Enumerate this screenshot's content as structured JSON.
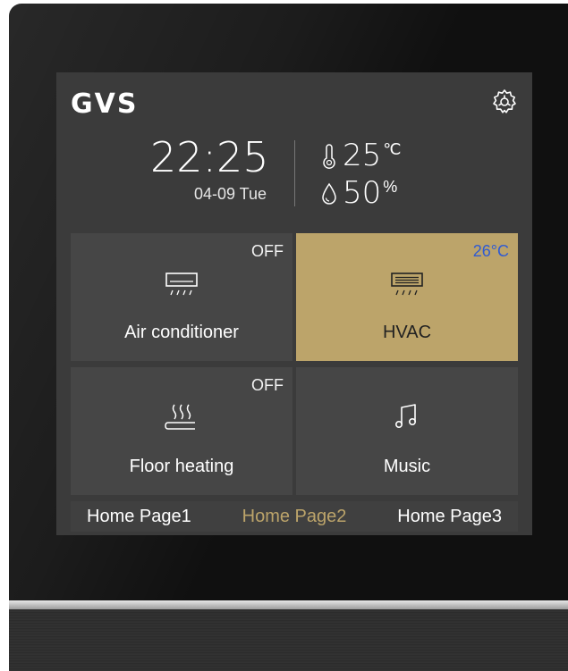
{
  "header": {
    "logo_text": "GVS",
    "settings_icon": "gear-icon"
  },
  "clock": {
    "time": "22:25",
    "date": "04-09 Tue"
  },
  "environment": {
    "temperature_value": "25",
    "temperature_unit": "℃",
    "humidity_value": "50",
    "humidity_unit": "%"
  },
  "tiles": [
    {
      "label": "Air conditioner",
      "status": "OFF",
      "icon": "air-conditioner-icon",
      "active": false
    },
    {
      "label": "HVAC",
      "status": "26°C",
      "icon": "hvac-icon",
      "active": true
    },
    {
      "label": "Floor heating",
      "status": "OFF",
      "icon": "floor-heating-icon",
      "active": false
    },
    {
      "label": "Music",
      "status": "",
      "icon": "music-note-icon",
      "active": false
    }
  ],
  "nav": {
    "pages": [
      "Home Page1",
      "Home Page2",
      "Home Page3"
    ],
    "selected": "Home Page2"
  },
  "colors": {
    "accent_gold": "#bca46a",
    "status_blue": "#2f5bd3",
    "tile_bg": "#464646",
    "screen_bg": "#3b3b3b"
  }
}
